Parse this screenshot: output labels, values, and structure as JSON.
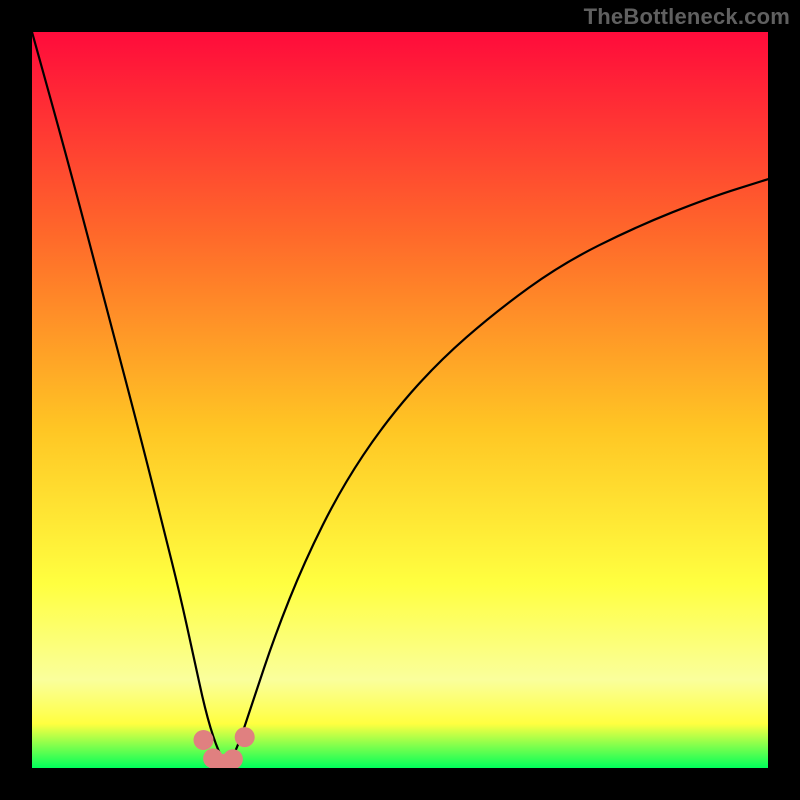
{
  "watermark": "TheBottleneck.com",
  "palette": {
    "frame": "#000000",
    "watermark_color": "#606060",
    "gradient_top": "#ff0b3b",
    "gradient_mid1": "#ff6a2a",
    "gradient_mid2": "#ffc624",
    "gradient_mid3": "#ffff40",
    "gradient_band": "#faff9c",
    "gradient_bottom": "#00ff5a",
    "curve": "#000000",
    "marker_fill": "#e08080",
    "marker_stroke": "#c05858"
  },
  "chart_data": {
    "type": "line",
    "title": "",
    "xlabel": "",
    "ylabel": "",
    "xlim": [
      0,
      100
    ],
    "ylim": [
      0,
      100
    ],
    "series": [
      {
        "name": "bottleneck-curve",
        "x": [
          0,
          5,
          10,
          15,
          18,
          20,
          22,
          23.5,
          25,
          26.5,
          28,
          30,
          33,
          37,
          42,
          48,
          55,
          63,
          72,
          82,
          92,
          100
        ],
        "y": [
          100,
          82,
          63,
          44,
          32,
          24,
          15,
          8,
          3,
          0,
          3,
          9,
          18,
          28,
          38,
          47,
          55,
          62,
          68.5,
          73.5,
          77.5,
          80
        ]
      }
    ],
    "markers": {
      "name": "highlighted-points",
      "x": [
        23.3,
        24.6,
        25.4,
        26.3,
        27.3,
        28.9
      ],
      "y": [
        3.8,
        1.3,
        0.5,
        0.6,
        1.2,
        4.2
      ]
    },
    "note": "Axis values are percentage-of-plot estimates; the original image has no numeric tick labels."
  }
}
